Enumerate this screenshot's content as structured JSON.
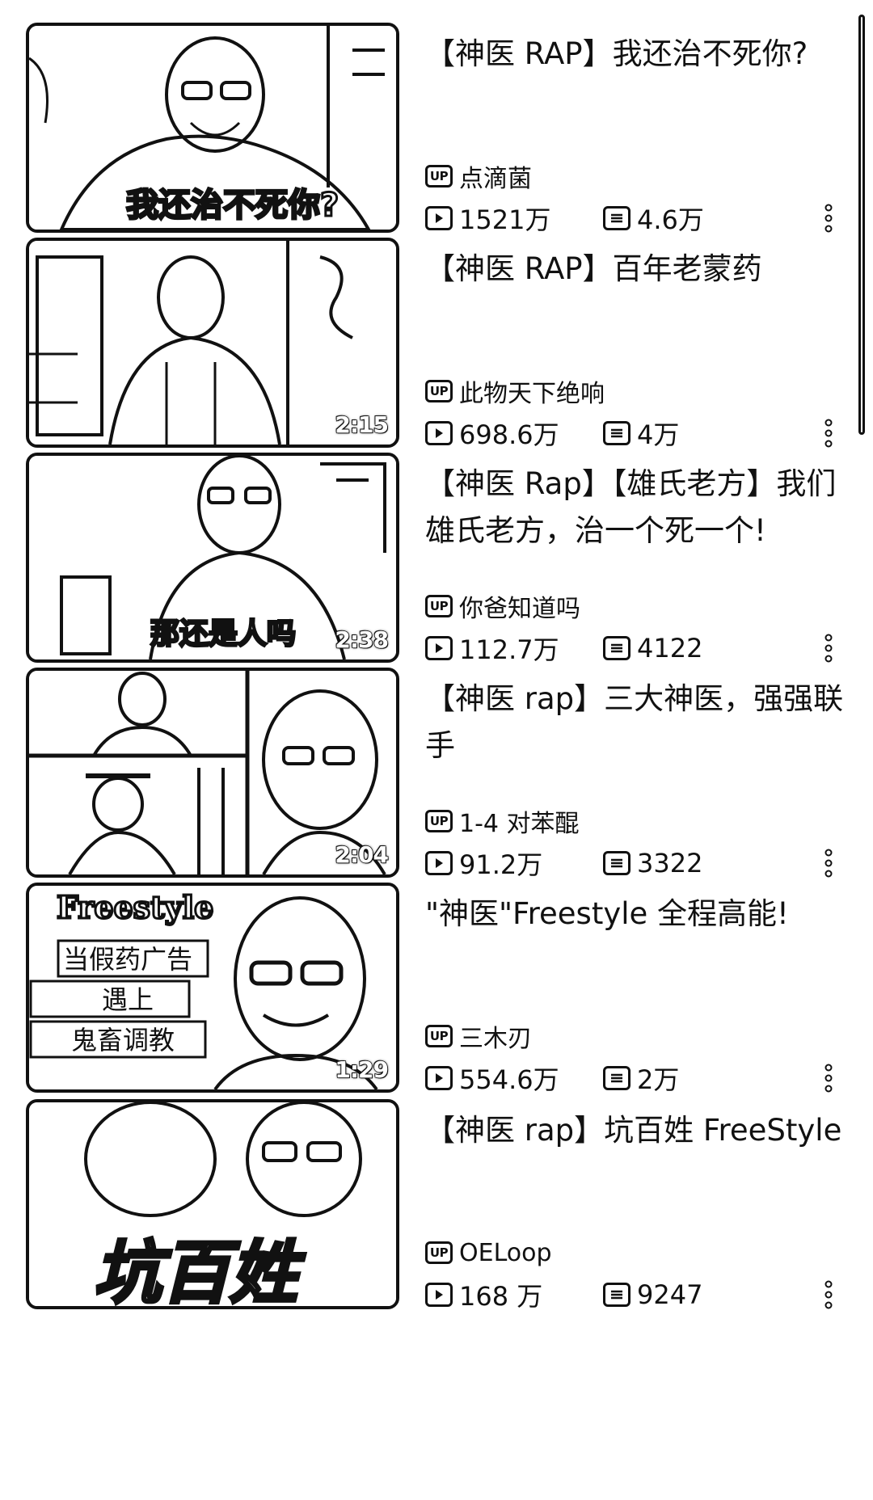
{
  "videos": [
    {
      "title": "【神医 RAP】我还治不死你?",
      "uploader": "点滴菌",
      "views": "1521万",
      "danmaku": "4.6万",
      "duration": "",
      "thumb_caption": "我还治不死你?"
    },
    {
      "title": "【神医 RAP】百年老蒙药",
      "uploader": "此物天下绝响",
      "views": "698.6万",
      "danmaku": "4万",
      "duration": "2:15",
      "thumb_caption": ""
    },
    {
      "title": "【神医 Rap】【雄氏老方】我们雄氏老方，治一个死一个!",
      "uploader": "你爸知道吗",
      "views": "112.7万",
      "danmaku": "4122",
      "duration": "2:38",
      "thumb_caption": "那还是人吗"
    },
    {
      "title": "【神医 rap】三大神医，强强联手",
      "uploader": "1-4 对苯醌",
      "views": "91.2万",
      "danmaku": "3322",
      "duration": "2:04",
      "thumb_caption": ""
    },
    {
      "title": "\"神医\"Freestyle  全程高能!",
      "uploader": "三木刃",
      "views": "554.6万",
      "danmaku": "2万",
      "duration": "1:29",
      "thumb_caption": "Freestyle",
      "thumb_lines": [
        "当假药广告",
        "遇上",
        "鬼畜调教"
      ]
    },
    {
      "title": "【神医 rap】坑百姓 FreeStyle",
      "uploader": "OELoop",
      "views": "168 万",
      "danmaku": "9247",
      "duration": "",
      "thumb_caption": "坑百姓"
    }
  ],
  "icons": {
    "up": "UP",
    "play": "play-icon",
    "danmaku": "danmaku-icon",
    "more": "more-vertical-icon"
  }
}
